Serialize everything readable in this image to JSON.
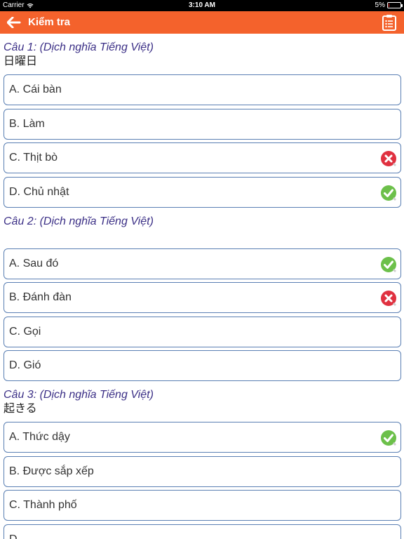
{
  "status": {
    "carrier": "Carrier",
    "time": "3:10 AM",
    "battery": "5%",
    "battery_level": 0.05
  },
  "header": {
    "title": "Kiểm tra",
    "back_icon": "back-arrow-icon",
    "menu_icon": "clipboard-list-icon",
    "color": "#f4622c"
  },
  "colors": {
    "question_title": "#3b2f86",
    "answer_border": "#5a7fb3",
    "correct": "#6cc04a",
    "wrong": "#e03140"
  },
  "questions": [
    {
      "title": "Câu 1: (Dịch nghĩa Tiếng Việt)",
      "word": "日曜日",
      "answers": [
        {
          "label": "A. Cái bàn",
          "mark": "none"
        },
        {
          "label": "B. Làm",
          "mark": "none"
        },
        {
          "label": "C. Thịt bò",
          "mark": "wrong"
        },
        {
          "label": "D. Chủ nhật",
          "mark": "correct"
        }
      ]
    },
    {
      "title": "Câu 2: (Dịch nghĩa Tiếng Việt)",
      "word": "",
      "answers": [
        {
          "label": "A. Sau đó",
          "mark": "correct"
        },
        {
          "label": "B. Đánh đàn",
          "mark": "wrong"
        },
        {
          "label": "C. Gọi",
          "mark": "none"
        },
        {
          "label": "D. Gió",
          "mark": "none"
        }
      ]
    },
    {
      "title": "Câu 3: (Dịch nghĩa Tiếng Việt)",
      "word": "起きる",
      "answers": [
        {
          "label": "A. Thức dậy",
          "mark": "correct"
        },
        {
          "label": "B. Được sắp xếp",
          "mark": "none"
        },
        {
          "label": "C. Thành phố",
          "mark": "none"
        },
        {
          "label": "D. ",
          "mark": "none"
        }
      ]
    }
  ]
}
